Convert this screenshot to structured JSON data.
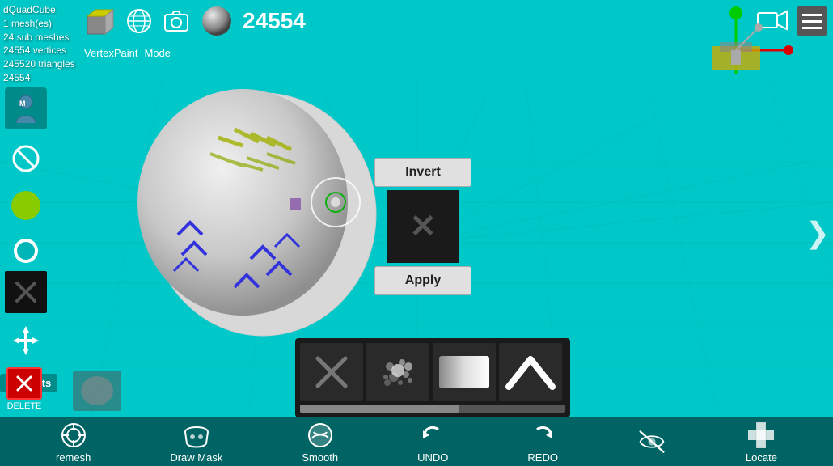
{
  "info": {
    "object_name": "dQuadCube",
    "mesh_count": "1 mesh(es)",
    "sub_meshes": "24 sub meshes",
    "vertices": "24554 vertices",
    "triangles": "245520 triangles",
    "vertex_id": "24554",
    "vertex_count_display": "24554"
  },
  "mode_labels": {
    "vertex_paint": "VertexPaint",
    "mode": "Mode"
  },
  "buttons": {
    "invert": "Invert",
    "apply": "Apply"
  },
  "nav": {
    "remesh_label": "remesh",
    "draw_mask_label": "Draw Mask",
    "smooth_label": "Smooth",
    "undo_label": "UNDO",
    "redo_label": "REDO",
    "locate_label": "Locate"
  },
  "icons": {
    "hamburger": "☰",
    "chevron_right": "❯",
    "x_mark": "✕",
    "brush_x": "✕",
    "brush_up": "∧"
  },
  "colors": {
    "background": "#00c0c0",
    "sidebar_bg": "rgba(0,0,0,0.35)",
    "nav_bg": "rgba(0,0,0,0.55)",
    "btn_bg": "#e0e0e0",
    "dark": "#1a1a1a"
  }
}
